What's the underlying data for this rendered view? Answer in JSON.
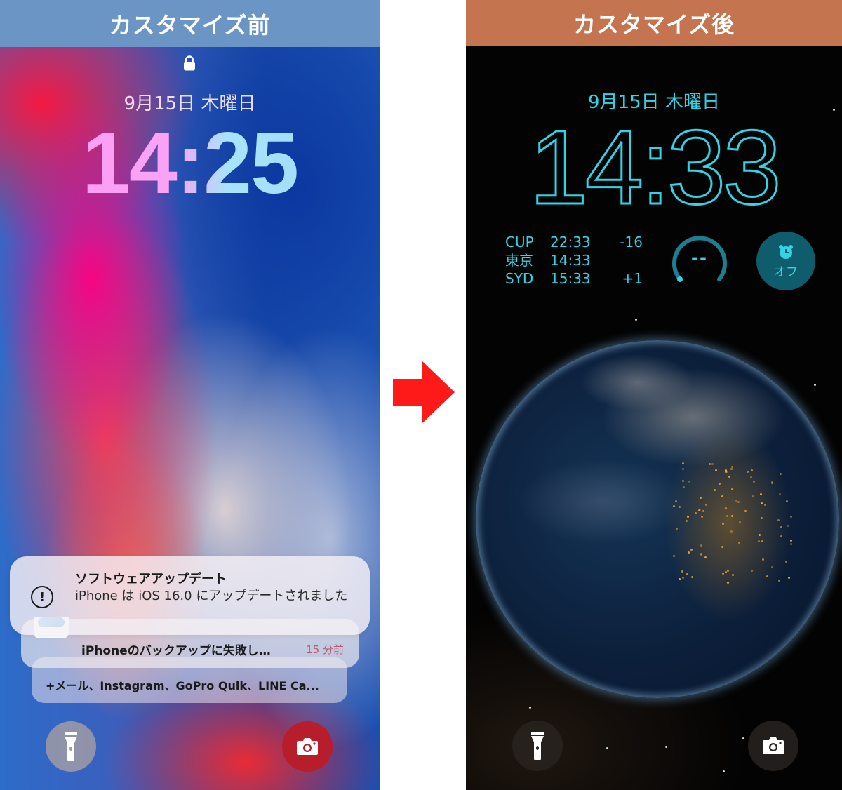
{
  "before": {
    "header": "カスタマイズ前",
    "header_color": "#6b95c4",
    "lock_icon": "lock-icon",
    "date": "9月15日 木曜日",
    "time": "14:25",
    "notifications": {
      "main": {
        "icon": "exclamation-circle-icon",
        "title": "ソフトウェアアップデート",
        "body": "iPhone は iOS 16.0 にアップデートされました"
      },
      "second": {
        "icon": "app-icon",
        "text": "iPhoneのバックアップに失敗し…",
        "time": "15 分前"
      },
      "more": {
        "text": "+メール、Instagram、GoPro Quik、LINE Ca..."
      }
    },
    "quick_actions": {
      "left": "flashlight-icon",
      "right": "camera-icon"
    }
  },
  "arrow": {
    "icon": "right-arrow-icon",
    "color": "#ff1a1a"
  },
  "after": {
    "header": "カスタマイズ後",
    "header_color": "#c4744f",
    "accent_color": "#33d3e6",
    "date": "9月15日 木曜日",
    "time": "14:33",
    "world_clock": [
      {
        "city": "CUP",
        "time": "22:33",
        "diff": "-16"
      },
      {
        "city": "東京",
        "time": "14:33",
        "diff": ""
      },
      {
        "city": "SYD",
        "time": "15:33",
        "diff": "+1"
      }
    ],
    "gauge": {
      "label": "--"
    },
    "alarm": {
      "icon": "alarm-clock-icon",
      "label": "オフ"
    },
    "wallpaper": "earth-at-night",
    "quick_actions": {
      "left": "flashlight-icon",
      "right": "camera-icon"
    }
  }
}
